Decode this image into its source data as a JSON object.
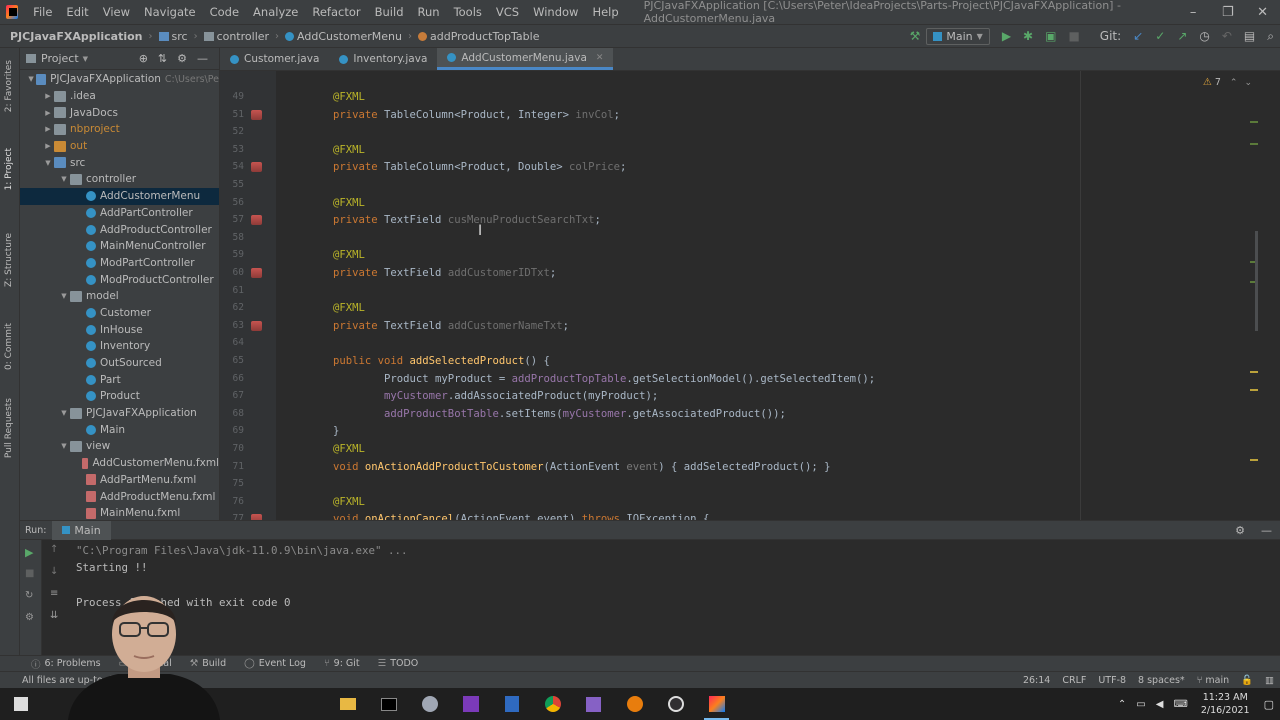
{
  "menubar": {
    "items": [
      "File",
      "Edit",
      "View",
      "Navigate",
      "Code",
      "Analyze",
      "Refactor",
      "Build",
      "Run",
      "Tools",
      "VCS",
      "Window",
      "Help"
    ],
    "title": "PJCJavaFXApplication [C:\\Users\\Peter\\IdeaProjects\\Parts-Project\\PJCJavaFXApplication] - AddCustomerMenu.java",
    "window_controls": [
      "–",
      "❐",
      "✕"
    ]
  },
  "navbar": {
    "crumbs": [
      "PJCJavaFXApplication",
      "src",
      "controller",
      "AddCustomerMenu",
      "addProductTopTable"
    ],
    "run_config": "Main",
    "git_label": "Git:"
  },
  "left_stripe": [
    "1: Project",
    "2: Favorites",
    "Z: Structure",
    "0: Commit",
    "Pull Requests"
  ],
  "project": {
    "title": "Project",
    "tree": [
      {
        "depth": 0,
        "arrow": "▼",
        "icon": "folder-blue",
        "label": "PJCJavaFXApplication",
        "path": "C:\\Users\\Pe"
      },
      {
        "depth": 1,
        "arrow": "▶",
        "icon": "folder",
        "label": ".idea"
      },
      {
        "depth": 1,
        "arrow": "▶",
        "icon": "folder",
        "label": "JavaDocs"
      },
      {
        "depth": 1,
        "arrow": "▶",
        "icon": "folder",
        "label": "nbproject"
      },
      {
        "depth": 1,
        "arrow": "▶",
        "icon": "folder-orange",
        "label": "out"
      },
      {
        "depth": 1,
        "arrow": "▼",
        "icon": "folder-blue",
        "label": "src"
      },
      {
        "depth": 2,
        "arrow": "▼",
        "icon": "folder",
        "label": "controller"
      },
      {
        "depth": 3,
        "arrow": "",
        "icon": "cls",
        "label": "AddCustomerMenu",
        "selected": true
      },
      {
        "depth": 3,
        "arrow": "",
        "icon": "cls",
        "label": "AddPartController"
      },
      {
        "depth": 3,
        "arrow": "",
        "icon": "cls",
        "label": "AddProductController"
      },
      {
        "depth": 3,
        "arrow": "",
        "icon": "cls",
        "label": "MainMenuController"
      },
      {
        "depth": 3,
        "arrow": "",
        "icon": "cls",
        "label": "ModPartController"
      },
      {
        "depth": 3,
        "arrow": "",
        "icon": "cls",
        "label": "ModProductController"
      },
      {
        "depth": 2,
        "arrow": "▼",
        "icon": "folder",
        "label": "model"
      },
      {
        "depth": 3,
        "arrow": "",
        "icon": "cls",
        "label": "Customer"
      },
      {
        "depth": 3,
        "arrow": "",
        "icon": "cls",
        "label": "InHouse"
      },
      {
        "depth": 3,
        "arrow": "",
        "icon": "cls",
        "label": "Inventory"
      },
      {
        "depth": 3,
        "arrow": "",
        "icon": "cls",
        "label": "OutSourced"
      },
      {
        "depth": 3,
        "arrow": "",
        "icon": "cls",
        "label": "Part"
      },
      {
        "depth": 3,
        "arrow": "",
        "icon": "cls",
        "label": "Product"
      },
      {
        "depth": 2,
        "arrow": "▼",
        "icon": "folder",
        "label": "PJCJavaFXApplication"
      },
      {
        "depth": 3,
        "arrow": "",
        "icon": "cls",
        "label": "Main"
      },
      {
        "depth": 2,
        "arrow": "▼",
        "icon": "folder",
        "label": "view"
      },
      {
        "depth": 3,
        "arrow": "",
        "icon": "fxml",
        "label": "AddCustomerMenu.fxml"
      },
      {
        "depth": 3,
        "arrow": "",
        "icon": "fxml",
        "label": "AddPartMenu.fxml"
      },
      {
        "depth": 3,
        "arrow": "",
        "icon": "fxml",
        "label": "AddProductMenu.fxml"
      },
      {
        "depth": 3,
        "arrow": "",
        "icon": "fxml",
        "label": "MainMenu.fxml"
      }
    ]
  },
  "tabs": [
    {
      "label": "Customer.java",
      "active": false
    },
    {
      "label": "Inventory.java",
      "active": false
    },
    {
      "label": "AddCustomerMenu.java",
      "active": true
    }
  ],
  "editor": {
    "warning_count": "7",
    "lines": [
      {
        "n": "49",
        "code": [
          [
            "ann",
            "@FXML"
          ]
        ]
      },
      {
        "n": "51",
        "mark": true,
        "code": [
          [
            "kw",
            "private "
          ],
          [
            "",
            "TableColumn<Product, Integer> "
          ],
          [
            "unused",
            "invCol"
          ],
          [
            "",
            ";"
          ]
        ]
      },
      {
        "n": "52",
        "code": []
      },
      {
        "n": "53",
        "code": [
          [
            "ann",
            "@FXML"
          ]
        ]
      },
      {
        "n": "54",
        "mark": true,
        "code": [
          [
            "kw",
            "private "
          ],
          [
            "",
            "TableColumn<Product, Double> "
          ],
          [
            "unused",
            "colPrice"
          ],
          [
            "",
            ";"
          ]
        ]
      },
      {
        "n": "55",
        "code": []
      },
      {
        "n": "56",
        "code": [
          [
            "ann",
            "@FXML"
          ]
        ]
      },
      {
        "n": "57",
        "mark": true,
        "code": [
          [
            "kw",
            "private "
          ],
          [
            "",
            "TextField "
          ],
          [
            "unused",
            "cusMenuProductSearchTxt"
          ],
          [
            "",
            ";"
          ]
        ]
      },
      {
        "n": "58",
        "code": []
      },
      {
        "n": "59",
        "code": [
          [
            "ann",
            "@FXML"
          ]
        ]
      },
      {
        "n": "60",
        "mark": true,
        "code": [
          [
            "kw",
            "private "
          ],
          [
            "",
            "TextField "
          ],
          [
            "unused",
            "addCustomerIDTxt"
          ],
          [
            "",
            ";"
          ]
        ]
      },
      {
        "n": "61",
        "code": []
      },
      {
        "n": "62",
        "code": [
          [
            "ann",
            "@FXML"
          ]
        ]
      },
      {
        "n": "63",
        "mark": true,
        "code": [
          [
            "kw",
            "private "
          ],
          [
            "",
            "TextField "
          ],
          [
            "unused",
            "addCustomerNameTxt"
          ],
          [
            "",
            ";"
          ]
        ]
      },
      {
        "n": "64",
        "code": []
      },
      {
        "n": "65",
        "code": [
          [
            "kw",
            "public void "
          ],
          [
            "fn",
            "addSelectedProduct"
          ],
          [
            "",
            "() {"
          ]
        ]
      },
      {
        "n": "66",
        "code": [
          [
            "",
            "        Product myProduct = "
          ],
          [
            "fld",
            "addProductTopTable"
          ],
          [
            "",
            ".getSelectionModel().getSelectedItem();"
          ]
        ]
      },
      {
        "n": "67",
        "code": [
          [
            "",
            "        "
          ],
          [
            "fld",
            "myCustomer"
          ],
          [
            "",
            ".addAssociatedProduct(myProduct);"
          ]
        ]
      },
      {
        "n": "68",
        "code": [
          [
            "",
            "        "
          ],
          [
            "fld",
            "addProductBotTable"
          ],
          [
            "",
            ".setItems("
          ],
          [
            "fld",
            "myCustomer"
          ],
          [
            "",
            ".getAssociatedProduct());"
          ]
        ]
      },
      {
        "n": "69",
        "code": [
          [
            "",
            "}"
          ]
        ]
      },
      {
        "n": "70",
        "code": [
          [
            "ann",
            "@FXML"
          ]
        ]
      },
      {
        "n": "71",
        "code": [
          [
            "kw",
            "void "
          ],
          [
            "fn",
            "onActionAddProductToCustomer"
          ],
          [
            "",
            "(ActionEvent "
          ],
          [
            "hint",
            "event"
          ],
          [
            "",
            ") { addSelectedProduct(); }"
          ]
        ]
      },
      {
        "n": "75",
        "code": []
      },
      {
        "n": "76",
        "code": [
          [
            "ann",
            "@FXML"
          ]
        ]
      },
      {
        "n": "77",
        "mark": true,
        "code": [
          [
            "kw",
            "void "
          ],
          [
            "fn",
            "onActionCancel"
          ],
          [
            "",
            "(ActionEvent event) "
          ],
          [
            "kw",
            "throws "
          ],
          [
            "",
            "IOException {"
          ]
        ]
      }
    ]
  },
  "run": {
    "label": "Run:",
    "tab": "Main",
    "output": [
      "\"C:\\Program Files\\Java\\jdk-11.0.9\\bin\\java.exe\" ...",
      "Starting !!",
      "",
      "Process finished with exit code 0"
    ]
  },
  "toolwindows": [
    "6: Problems",
    "Terminal",
    "Build",
    "Event Log",
    "9: Git",
    "TODO"
  ],
  "status": {
    "message": "All files are up-to-date",
    "position": "26:14",
    "line_sep": "CRLF",
    "encoding": "UTF-8",
    "indent": "8 spaces*",
    "branch": "main"
  },
  "taskbar": {
    "time": "11:23 AM",
    "date": "2/16/2021"
  },
  "colors": {
    "accent": "#4a88c7",
    "keyword": "#cc7832",
    "annotation": "#bbb529",
    "field": "#9876aa"
  }
}
